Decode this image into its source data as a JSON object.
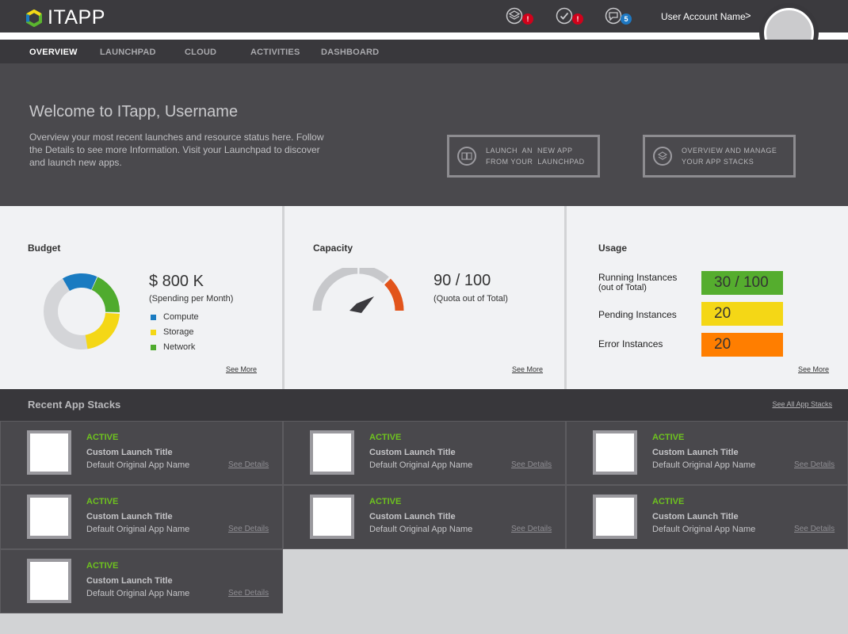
{
  "app": {
    "logo_text": "ITAPP"
  },
  "header": {
    "notifications": [
      {
        "icon": "layers-icon",
        "badge": "!",
        "badge_color": "#d0021b"
      },
      {
        "icon": "check-circle-icon",
        "badge": "!",
        "badge_color": "#d0021b"
      },
      {
        "icon": "chat-bubble-icon",
        "badge": "5",
        "badge_color": "#1e78c2"
      }
    ],
    "user_name": "User Account Name",
    "user_chevron": ">"
  },
  "nav": {
    "tabs": [
      {
        "label": "OVERVIEW",
        "active": true
      },
      {
        "label": "LAUNCHPAD",
        "active": false
      },
      {
        "label": "CLOUD",
        "active": false
      },
      {
        "label": "ACTIVITIES",
        "active": false
      },
      {
        "label": "DASHBOARD",
        "active": false
      }
    ]
  },
  "hero": {
    "title": "Welcome to ITapp, Username",
    "description": "Overview your most recent launches and resource status here. Follow the Details to see more Information. Visit your Launchpad to discover and launch new apps.",
    "buttons": [
      {
        "line1": "LAUNCH  AN  NEW APP",
        "line2": "FROM YOUR  LAUNCHPAD",
        "icon": "book-icon"
      },
      {
        "line1": "OVERVIEW AND MANAGE",
        "line2": "YOUR APP STACKS",
        "icon": "layers-icon"
      }
    ]
  },
  "budget": {
    "title": "Budget",
    "value": "$ 800 K",
    "subtitle": "(Spending per Month)",
    "legend": [
      {
        "label": "Compute",
        "color": "#1a7bc1"
      },
      {
        "label": "Storage",
        "color": "#f4d716"
      },
      {
        "label": "Network",
        "color": "#4fab2e"
      }
    ],
    "see_more": "See More"
  },
  "capacity": {
    "title": "Capacity",
    "value": "90 / 100",
    "subtitle": "(Quota out of Total)",
    "used_fraction": 0.9,
    "see_more": "See More"
  },
  "usage": {
    "title": "Usage",
    "rows": [
      {
        "label_line1": "Running Instances",
        "label_line2": "(out of Total)",
        "value": "30 / 100",
        "color": "#55ad2e"
      },
      {
        "label_line1": "Pending Instances",
        "label_line2": "",
        "value": "20",
        "color": "#f4d716"
      },
      {
        "label_line1": "Error Instances",
        "label_line2": "",
        "value": "20",
        "color": "#ff7e00"
      }
    ],
    "see_more": "See More"
  },
  "recent": {
    "title": "Recent App Stacks",
    "see_all": "See All App Stacks",
    "stacks": [
      {
        "status": "ACTIVE",
        "title": "Custom Launch Title",
        "app": "Default Original App Name",
        "details": "See Details"
      },
      {
        "status": "ACTIVE",
        "title": "Custom Launch Title",
        "app": "Default Original App Name",
        "details": "See Details"
      },
      {
        "status": "ACTIVE",
        "title": "Custom Launch Title",
        "app": "Default Original App Name",
        "details": "See Details"
      },
      {
        "status": "ACTIVE",
        "title": "Custom Launch Title",
        "app": "Default Original App Name",
        "details": "See Details"
      },
      {
        "status": "ACTIVE",
        "title": "Custom Launch Title",
        "app": "Default Original App Name",
        "details": "See Details"
      },
      {
        "status": "ACTIVE",
        "title": "Custom Launch Title",
        "app": "Default Original App Name",
        "details": "See Details"
      },
      {
        "status": "ACTIVE",
        "title": "Custom Launch Title",
        "app": "Default Original App Name",
        "details": "See Details"
      }
    ]
  }
}
